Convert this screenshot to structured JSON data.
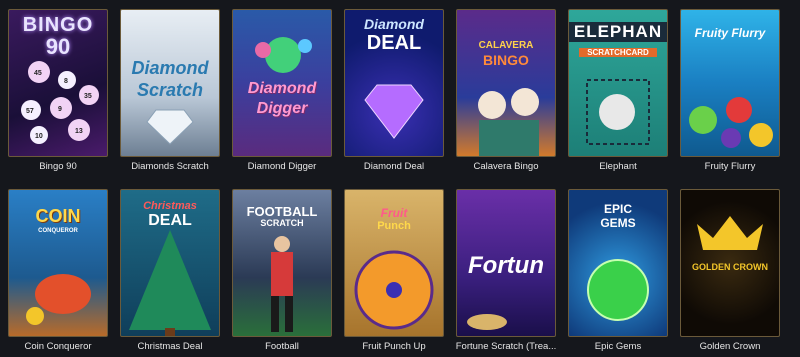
{
  "games": [
    {
      "title": "Bingo 90",
      "logo_lines": [
        "BINGO",
        "90"
      ],
      "balls": [
        "45",
        "8",
        "35",
        "57",
        "9",
        "10",
        "13"
      ]
    },
    {
      "title": "Diamonds Scratch",
      "logo_lines": [
        "Diamond",
        "Scratch"
      ]
    },
    {
      "title": "Diamond Digger",
      "logo_lines": [
        "Diamond",
        "Digger"
      ]
    },
    {
      "title": "Diamond Deal",
      "logo_lines": [
        "Diamond",
        "DEAL"
      ]
    },
    {
      "title": "Calavera Bingo",
      "logo_lines": [
        "CALAVERA",
        "BINGO"
      ]
    },
    {
      "title": "Elephant",
      "logo_lines": [
        "ELEPHAN",
        "SCRATCHCARD"
      ]
    },
    {
      "title": "Fruity Flurry",
      "logo_lines": [
        "Fruity Flurry"
      ]
    },
    {
      "title": "Coin Conqueror",
      "logo_lines": [
        "COIN",
        "CONQUEROR"
      ]
    },
    {
      "title": "Christmas Deal",
      "logo_lines": [
        "Christmas",
        "DEAL"
      ]
    },
    {
      "title": "Football",
      "logo_lines": [
        "FOOTBALL",
        "SCRATCH"
      ]
    },
    {
      "title": "Fruit Punch Up",
      "logo_lines": [
        "Fruit",
        "Punch"
      ]
    },
    {
      "title": "Fortune Scratch (Trea...",
      "logo_lines": [
        "Fortun"
      ]
    },
    {
      "title": "Epic Gems",
      "logo_lines": [
        "EPIC",
        "GEMS"
      ]
    },
    {
      "title": "Golden Crown",
      "logo_lines": [
        "GOLDEN CROWN"
      ]
    }
  ]
}
